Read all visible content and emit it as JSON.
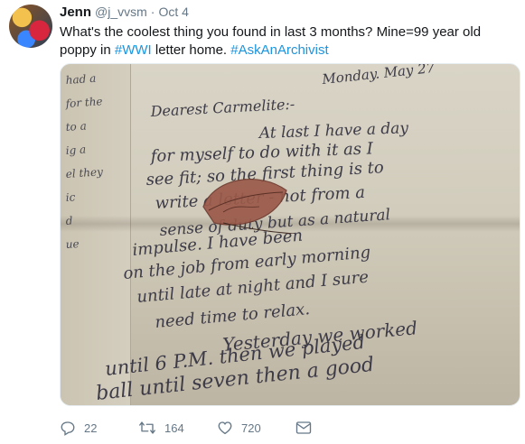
{
  "tweet": {
    "display_name": "Jenn",
    "handle": "@j_vvsm",
    "separator": "·",
    "time": "Oct 4",
    "text_part1": "What's the coolest thing you found in last 3 months? Mine=99 year old poppy in",
    "hashtag1": "#WWI",
    "text_part2": " letter home.  ",
    "hashtag2": "#AskAnArchivist"
  },
  "media": {
    "letter_lines": [
      "Monday. May 27",
      "Dearest Carmelite:-",
      "At last I have a day",
      "for myself to do with it as I",
      "see fit; so the first thing is to",
      "write a letter - not from a",
      "sense of duty but as a natural",
      "impulse. I have been",
      "on the job from early morning",
      "until late at night and I sure",
      "need time to relax.",
      "Yesterday we worked",
      "until 6 P.M. then we played",
      "ball until seven then a good"
    ],
    "left_page_lines": [
      "had a",
      "for the",
      "to a",
      "ig a",
      "el they",
      "ic",
      "d",
      "ue"
    ]
  },
  "actions": {
    "reply_count": "22",
    "retweet_count": "164",
    "like_count": "720",
    "icons": [
      "reply-icon",
      "retweet-icon",
      "like-icon",
      "direct-message-icon"
    ],
    "icon_color": "#657786"
  },
  "colors": {
    "link": "#1b95e0",
    "text": "#14171a",
    "muted": "#657786"
  }
}
